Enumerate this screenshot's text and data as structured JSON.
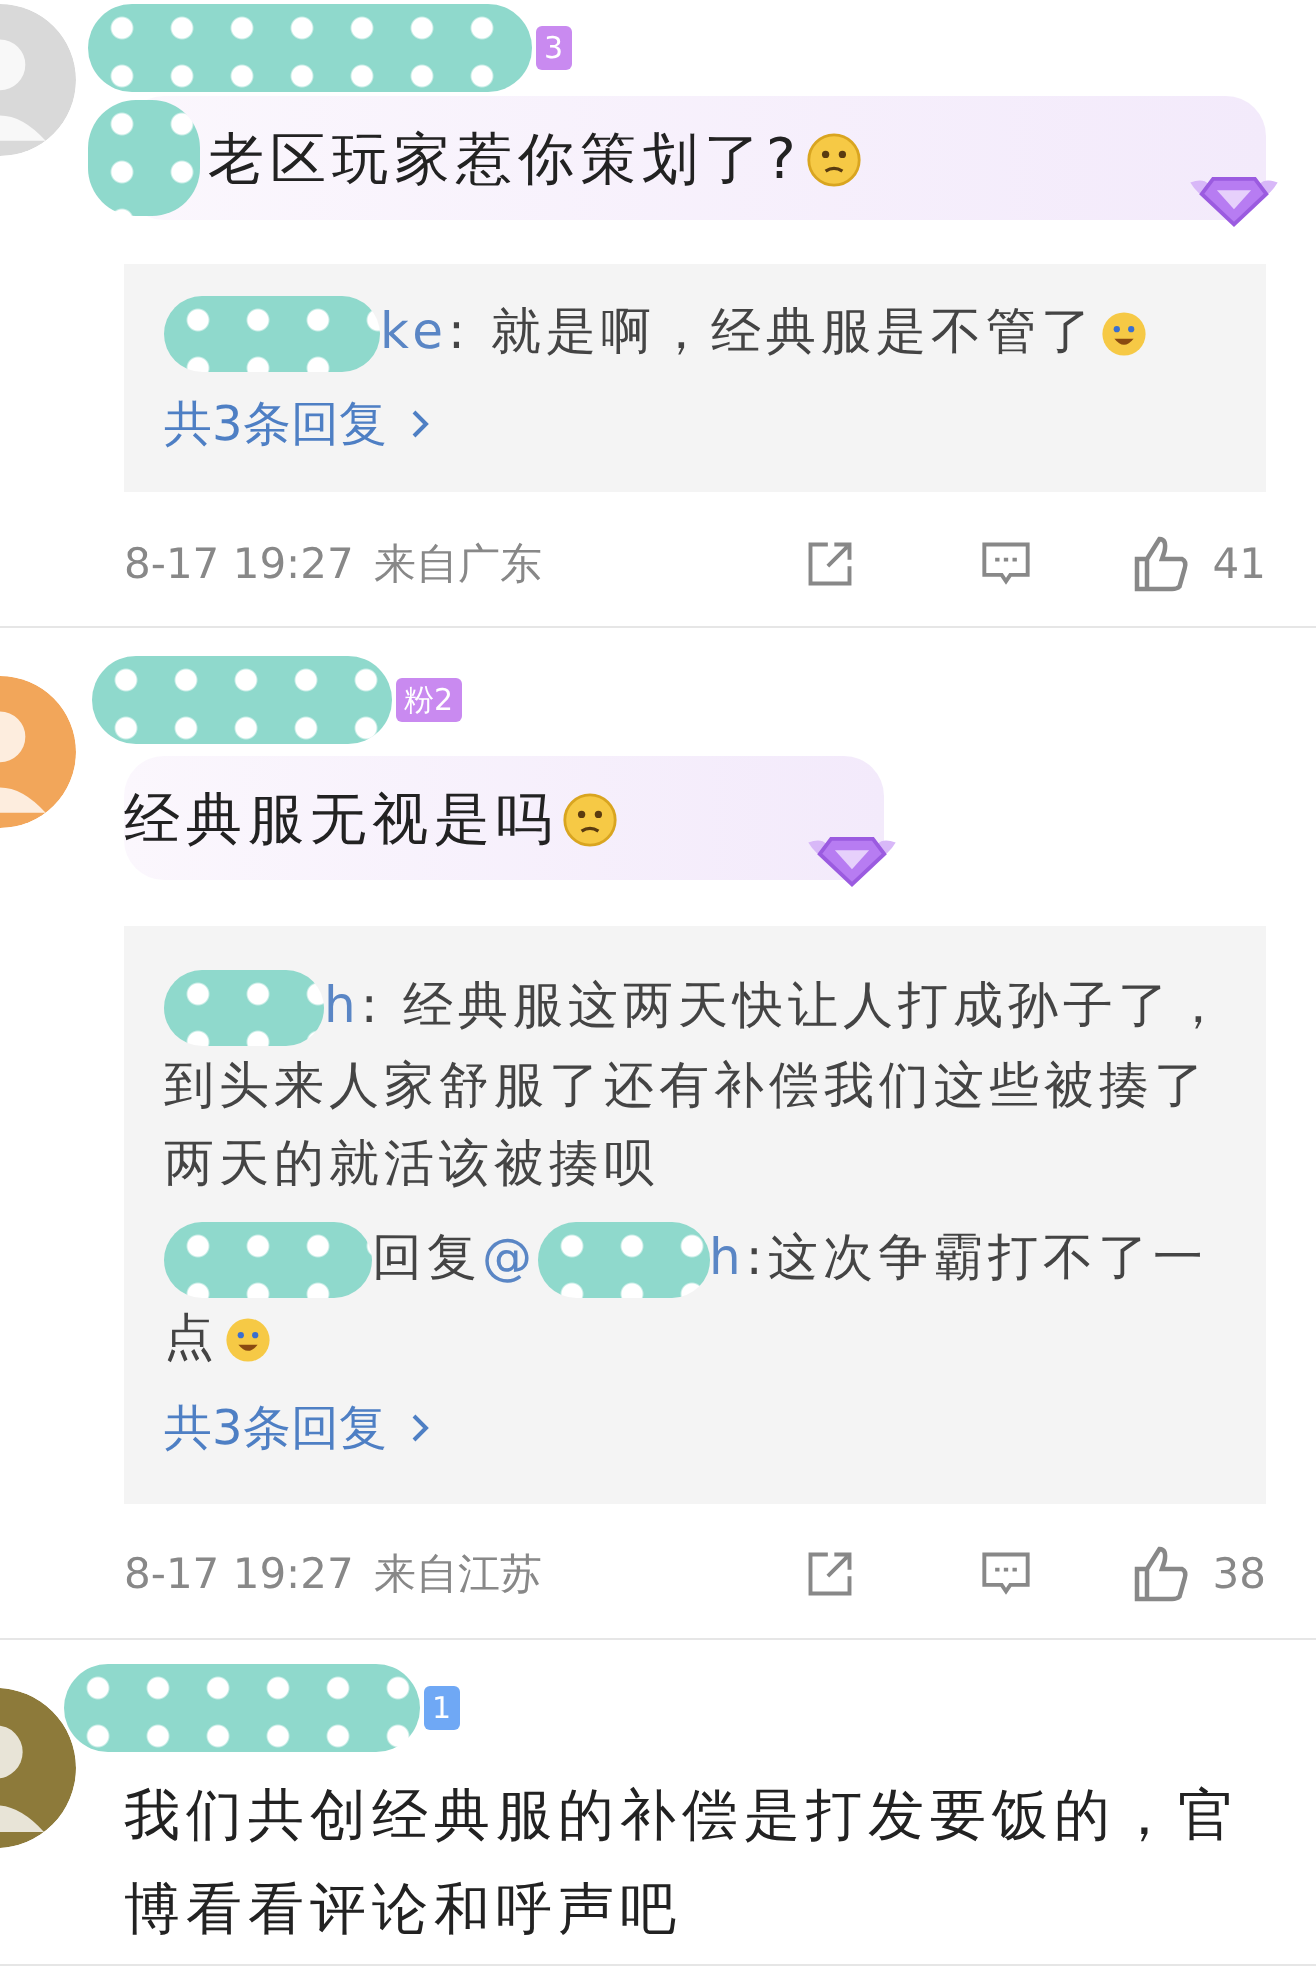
{
  "comments": [
    {
      "badge": {
        "text": "3",
        "color": "#c98af0"
      },
      "text": "老区玩家惹你策划了?",
      "trailing_emoji": true,
      "bubble": true,
      "replies": [
        {
          "name_tail": "ke",
          "text": ": 就是啊，经典服是不管了",
          "trailing_emoji": true
        }
      ],
      "more_replies": "共3条回复",
      "time": "8-17 19:27",
      "location": "来自广东",
      "likes": "41"
    },
    {
      "badge": {
        "text": "粉2",
        "color": "#c98af0"
      },
      "text": "经典服无视是吗",
      "trailing_emoji": true,
      "bubble": true,
      "replies": [
        {
          "name_tail": "h",
          "text": ": 经典服这两天快让人打成孙子了，到头来人家舒服了还有补偿我们这些被揍了两天的就活该被揍呗",
          "trailing_emoji": false
        },
        {
          "prefix": "回复",
          "mention_head": "@",
          "mention_tail": "h",
          "text": ":这次争霸打不了一点",
          "trailing_emoji": true
        }
      ],
      "more_replies": "共3条回复",
      "time": "8-17 19:27",
      "location": "来自江苏",
      "likes": "38"
    },
    {
      "badge": {
        "text": "1",
        "color": "#6fa8f5"
      },
      "text": "我们共创经典服的补偿是打发要饭的，官博看看评论和呼声吧",
      "trailing_emoji": false,
      "bubble": false
    }
  ]
}
